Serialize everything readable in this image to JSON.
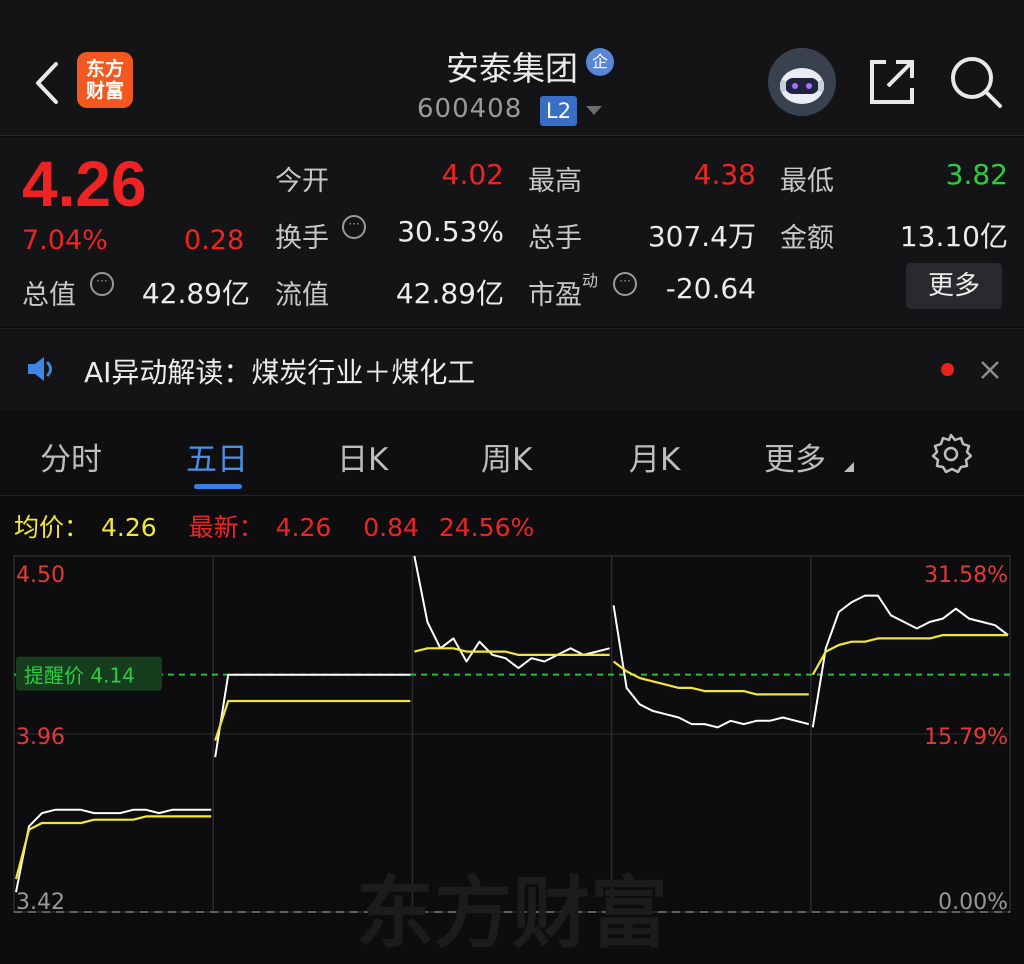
{
  "header": {
    "logo_line1": "东方",
    "logo_line2": "财富",
    "stock_name": "安泰集团",
    "badge": "企",
    "stock_code": "600408",
    "level": "L2"
  },
  "quote": {
    "price": "4.26",
    "change_pct": "7.04%",
    "change_amt": "0.28",
    "open_label": "今开",
    "open": "4.02",
    "high_label": "最高",
    "high": "4.38",
    "low_label": "最低",
    "low": "3.82",
    "turnover_label": "换手",
    "turnover": "30.53%",
    "volume_label": "总手",
    "volume": "307.4万",
    "amount_label": "金额",
    "amount": "13.10亿",
    "mktcap_label": "总值",
    "mktcap": "42.89亿",
    "float_label": "流值",
    "float_cap": "42.89亿",
    "pe_label": "市盈",
    "pe_sup": "动",
    "pe": "-20.64",
    "more_label": "更多",
    "status_colors": {
      "up": "#ee2424",
      "down": "#2ecc40"
    }
  },
  "ai": {
    "text": "AI异动解读：煤炭行业＋煤化工"
  },
  "tabs": [
    "分时",
    "五日",
    "日K",
    "周K",
    "月K",
    "更多"
  ],
  "legend": {
    "avg_label": "均价：",
    "avg": "4.26",
    "latest_label": "最新：",
    "latest": "4.26",
    "latest_chg": "0.84",
    "latest_pct": "24.56%"
  },
  "chart_data": {
    "type": "line",
    "title": "",
    "xlabel": "",
    "ylabel": "",
    "ylim": [
      3.42,
      4.5
    ],
    "y_ticks_left": [
      "4.50",
      "3.96",
      "3.42"
    ],
    "y_ticks_right": [
      "31.58%",
      "15.79%",
      "0.00%"
    ],
    "days": 5,
    "alert_label": "提醒价 4.14",
    "alert_price": 4.14,
    "series": [
      {
        "color": "#ffffff",
        "values": [
          [
            3.48,
            3.68,
            3.72,
            3.73,
            3.73,
            3.73,
            3.72,
            3.72,
            3.72,
            3.73,
            3.73,
            3.72,
            3.73,
            3.73,
            3.73,
            3.73
          ],
          [
            3.89,
            4.14,
            4.14,
            4.14,
            4.14,
            4.14,
            4.14,
            4.14,
            4.14,
            4.14,
            4.14,
            4.14,
            4.14,
            4.14,
            4.14,
            4.14
          ],
          [
            4.5,
            4.3,
            4.22,
            4.25,
            4.18,
            4.24,
            4.2,
            4.19,
            4.16,
            4.19,
            4.18,
            4.2,
            4.22,
            4.2,
            4.21,
            4.22
          ],
          [
            4.35,
            4.1,
            4.05,
            4.03,
            4.02,
            4.01,
            3.99,
            3.99,
            3.98,
            4.0,
            3.99,
            4.0,
            4.0,
            4.01,
            4.0,
            3.99
          ],
          [
            3.98,
            4.22,
            4.33,
            4.36,
            4.38,
            4.38,
            4.32,
            4.3,
            4.28,
            4.3,
            4.31,
            4.34,
            4.31,
            4.3,
            4.29,
            4.26
          ]
        ]
      },
      {
        "color": "#f2e63a",
        "values": [
          [
            3.52,
            3.67,
            3.69,
            3.69,
            3.69,
            3.69,
            3.7,
            3.7,
            3.7,
            3.7,
            3.71,
            3.71,
            3.71,
            3.71,
            3.71,
            3.71
          ],
          [
            3.94,
            4.06,
            4.06,
            4.06,
            4.06,
            4.06,
            4.06,
            4.06,
            4.06,
            4.06,
            4.06,
            4.06,
            4.06,
            4.06,
            4.06,
            4.06
          ],
          [
            4.21,
            4.22,
            4.22,
            4.22,
            4.21,
            4.21,
            4.21,
            4.21,
            4.2,
            4.2,
            4.2,
            4.2,
            4.2,
            4.2,
            4.2,
            4.2
          ],
          [
            4.18,
            4.15,
            4.13,
            4.12,
            4.11,
            4.1,
            4.1,
            4.09,
            4.09,
            4.09,
            4.09,
            4.08,
            4.08,
            4.08,
            4.08,
            4.08
          ],
          [
            4.14,
            4.21,
            4.23,
            4.24,
            4.24,
            4.25,
            4.25,
            4.25,
            4.25,
            4.25,
            4.26,
            4.26,
            4.26,
            4.26,
            4.26,
            4.26
          ]
        ]
      }
    ],
    "watermark": "东方财富"
  }
}
